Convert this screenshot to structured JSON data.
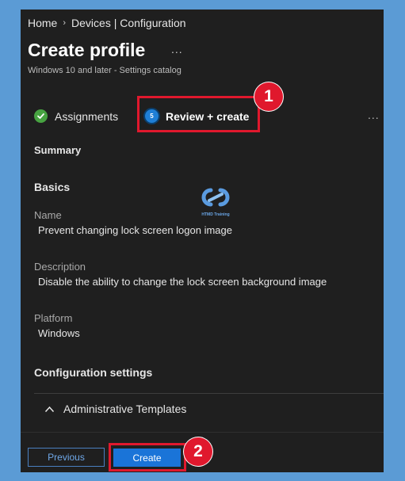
{
  "breadcrumb": {
    "home": "Home",
    "separator": "›",
    "devices": "Devices | Configuration"
  },
  "page": {
    "title": "Create profile",
    "more": "...",
    "subtitle": "Windows 10 and later - Settings catalog"
  },
  "wizard": {
    "assignments": {
      "label": "Assignments",
      "status": "completed",
      "icon": "checkmark-icon"
    },
    "review": {
      "label": "Review + create",
      "number": "5",
      "status": "current"
    },
    "overflow": "..."
  },
  "summary": {
    "heading": "Summary",
    "basics_heading": "Basics",
    "fields": [
      {
        "label": "Name",
        "value": "Prevent changing lock screen logon image"
      },
      {
        "label": "Description",
        "value": "Disable the ability to change the lock screen background image"
      },
      {
        "label": "Platform",
        "value": "Windows"
      }
    ],
    "config_heading": "Configuration settings",
    "accordion_label": "Administrative Templates",
    "accordion_icon": "chevron-up-icon"
  },
  "footer": {
    "previous_label": "Previous",
    "create_label": "Create"
  },
  "callouts": [
    {
      "number": "1"
    },
    {
      "number": "2"
    }
  ],
  "watermark": {
    "text": "HTMD Training"
  },
  "colors": {
    "panel": "#1f1f1f",
    "background": "#5b9bd5",
    "accent": "#1a74d8",
    "callout": "#e0182d",
    "success": "#47a341"
  }
}
